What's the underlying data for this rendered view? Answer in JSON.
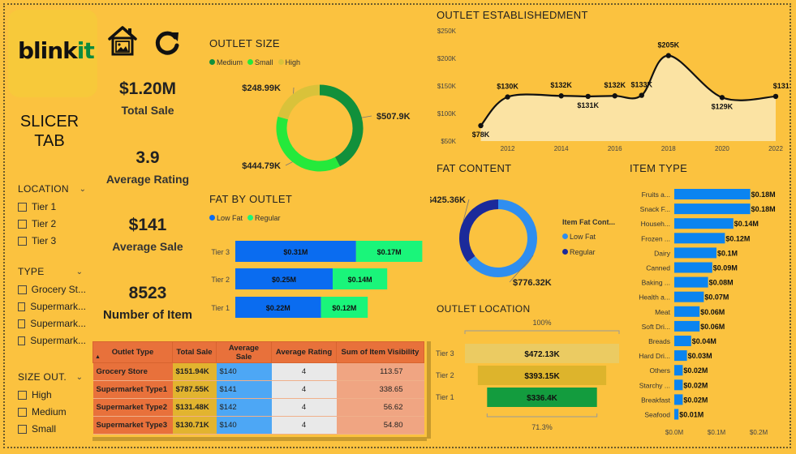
{
  "brand": {
    "logo_text_a": "blink",
    "logo_text_b": "it"
  },
  "icons": {
    "home": "home-image-icon",
    "refresh": "refresh-icon"
  },
  "slicer": {
    "title_line1": "SLICER",
    "title_line2": "TAB",
    "location": {
      "label": "LOCATION",
      "items": [
        "Tier 1",
        "Tier 2",
        "Tier 3"
      ]
    },
    "type": {
      "label": "TYPE",
      "items": [
        "Grocery St...",
        "Supermark...",
        "Supermark...",
        "Supermark..."
      ]
    },
    "size": {
      "label": "SIZE OUT.",
      "items": [
        "High",
        "Medium",
        "Small"
      ]
    }
  },
  "kpis": {
    "total_sale": {
      "value": "$1.20M",
      "label": "Total Sale"
    },
    "avg_rating": {
      "value": "3.9",
      "label": "Average Rating"
    },
    "avg_sale": {
      "value": "$141",
      "label": "Average Sale"
    },
    "num_items": {
      "value": "8523",
      "label": "Number of Item"
    }
  },
  "colors": {
    "background": "#FBC23F",
    "medium": "#11903B",
    "small": "#25E93B",
    "high": "#D9C23A",
    "low_fat": "#0A6CF0",
    "regular": "#1AF57A",
    "fat_regular_donut": "#1B2A9A",
    "fat_low_donut": "#2F8EF0",
    "item_bar": "#0B84F0",
    "tier3": "#EBCB62",
    "tier2": "#DDB42C",
    "tier1": "#139C3E",
    "area_fill": "#FBE3A3"
  },
  "chart_data": [
    {
      "id": "outlet_size",
      "type": "pie",
      "title": "OUTLET SIZE",
      "legend": [
        "Medium",
        "Small",
        "High"
      ],
      "categories": [
        "Medium",
        "Small",
        "High"
      ],
      "values": [
        507.9,
        444.79,
        248.99
      ],
      "labels": [
        "$507.9K",
        "$444.79K",
        "$248.99K"
      ]
    },
    {
      "id": "outlet_establishment",
      "type": "line",
      "title": "OUTLET ESTABLISHEDMENT",
      "x": [
        2011,
        2012,
        2014,
        2015,
        2016,
        2017,
        2018,
        2020,
        2022
      ],
      "values": [
        78,
        130,
        132,
        131,
        132,
        133,
        205,
        129,
        131
      ],
      "labels": [
        "$78K",
        "$130K",
        "$132K",
        "$131K",
        "$132K",
        "$133K",
        "$205K",
        "$129K",
        "$131K"
      ],
      "xticks": [
        "2012",
        "2014",
        "2016",
        "2018",
        "2020",
        "2022"
      ],
      "yticks": [
        "$50K",
        "$100K",
        "$150K",
        "$200K",
        "$250K"
      ],
      "ylim": [
        50,
        250
      ],
      "xlim": [
        2010.5,
        2022
      ]
    },
    {
      "id": "fat_by_outlet",
      "type": "bar",
      "title": "FAT BY OUTLET",
      "legend": [
        "Low Fat",
        "Regular"
      ],
      "categories": [
        "Tier 3",
        "Tier 2",
        "Tier 1"
      ],
      "series": [
        {
          "name": "Low Fat",
          "values": [
            0.31,
            0.25,
            0.22
          ],
          "labels": [
            "$0.31M",
            "$0.25M",
            "$0.22M"
          ]
        },
        {
          "name": "Regular",
          "values": [
            0.17,
            0.14,
            0.12
          ],
          "labels": [
            "$0.17M",
            "$0.14M",
            "$0.12M"
          ]
        }
      ]
    },
    {
      "id": "fat_content",
      "type": "pie",
      "title": "FAT CONTENT",
      "legend_title": "Item Fat Cont...",
      "legend": [
        "Low Fat",
        "Regular"
      ],
      "categories": [
        "Low Fat",
        "Regular"
      ],
      "values": [
        776.32,
        425.36
      ],
      "labels": [
        "$776.32K",
        "$425.36K"
      ]
    },
    {
      "id": "item_type",
      "type": "bar",
      "title": "ITEM TYPE",
      "categories": [
        "Fruits a...",
        "Snack F...",
        "Househ...",
        "Frozen ...",
        "Dairy",
        "Canned",
        "Baking ...",
        "Health a...",
        "Meat",
        "Soft Dri...",
        "Breads",
        "Hard Dri...",
        "Others",
        "Starchy ...",
        "Breakfast",
        "Seafood"
      ],
      "values": [
        0.18,
        0.18,
        0.14,
        0.12,
        0.1,
        0.09,
        0.08,
        0.07,
        0.06,
        0.06,
        0.04,
        0.03,
        0.02,
        0.02,
        0.02,
        0.01
      ],
      "labels": [
        "$0.18M",
        "$0.18M",
        "$0.14M",
        "$0.12M",
        "$0.1M",
        "$0.09M",
        "$0.08M",
        "$0.07M",
        "$0.06M",
        "$0.06M",
        "$0.04M",
        "$0.03M",
        "$0.02M",
        "$0.02M",
        "$0.02M",
        "$0.01M"
      ],
      "xticks": [
        "$0.0M",
        "$0.1M",
        "$0.2M"
      ],
      "xlim": [
        0,
        0.2
      ]
    },
    {
      "id": "outlet_location",
      "type": "bar",
      "title": "OUTLET LOCATION",
      "categories": [
        "Tier 3",
        "Tier 2",
        "Tier 1"
      ],
      "values": [
        472.13,
        393.15,
        336.4
      ],
      "labels": [
        "$472.13K",
        "$393.15K",
        "$336.4K"
      ],
      "top_label": "100%",
      "bottom_label": "71.3%"
    },
    {
      "id": "outlet_type_table",
      "type": "table",
      "columns": [
        "Outlet Type",
        "Total Sale",
        "Average Sale",
        "Average Rating",
        "Sum of Item Visibility"
      ],
      "rows": [
        [
          "Grocery Store",
          "$151.94K",
          "$140",
          "4",
          "113.57"
        ],
        [
          "Supermarket Type1",
          "$787.55K",
          "$141",
          "4",
          "338.65"
        ],
        [
          "Supermarket Type2",
          "$131.48K",
          "$142",
          "4",
          "56.62"
        ],
        [
          "Supermarket Type3",
          "$130.71K",
          "$140",
          "4",
          "54.80"
        ]
      ]
    }
  ]
}
